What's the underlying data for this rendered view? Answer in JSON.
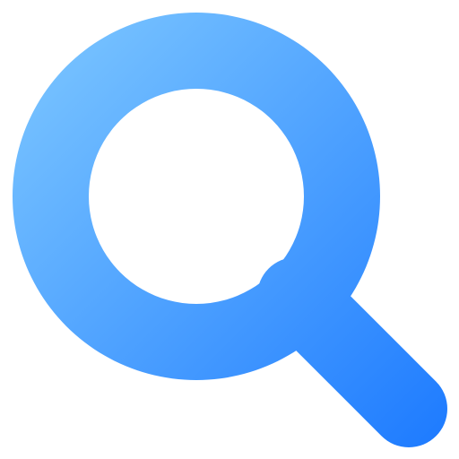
{
  "icon": {
    "name": "search-icon",
    "gradient": {
      "start": "#82CBFF",
      "end": "#1A78FF"
    }
  }
}
